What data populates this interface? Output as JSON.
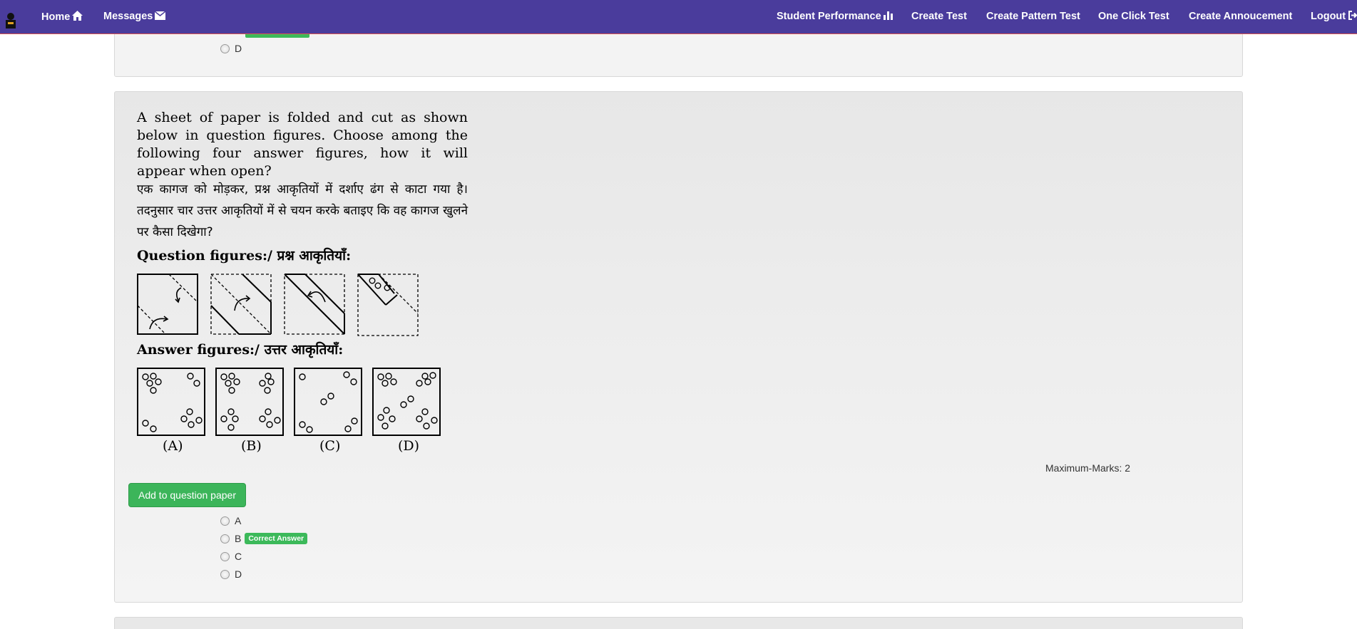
{
  "nav": {
    "home": "Home",
    "messages": "Messages",
    "student_performance": "Student Performance",
    "create_test": "Create Test",
    "create_pattern_test": "Create Pattern Test",
    "one_click_test": "One Click Test",
    "create_announcement": "Create Annoucement",
    "logout": "Logout",
    "icons": [
      "home-icon",
      "envelope-icon",
      "bar-chart-icon",
      "logout-icon"
    ]
  },
  "previous_question": {
    "options": [
      "D"
    ]
  },
  "question": {
    "text_en": "A sheet of paper is folded and cut as shown below in question figures. Choose among the following four answer figures, how it will appear when open?",
    "text_hi": "एक कागज को मोड़कर, प्रश्न आकृतियों में दर्शाए ढंग से काटा गया है। तदनुसार चार उत्तर आकृतियों में से चयन करके बताइए कि वह कागज खुलने पर कैसा दिखेगा?",
    "question_figures_heading": "Question figures:/ प्रश्न आकृतियाँ:",
    "answer_figures_heading": "Answer figures:/ उत्तर आकृतियाँ:",
    "answer_figure_labels": [
      "(A)",
      "(B)",
      "(C)",
      "(D)"
    ],
    "max_marks": "Maximum-Marks: 2",
    "add_button": "Add to question paper",
    "options": [
      "A",
      "B",
      "C",
      "D"
    ],
    "correct_badge": "Correct Answer",
    "correct_option": "B"
  },
  "colors": {
    "navbar": "#4a3c9c",
    "success": "#3cb55a"
  }
}
